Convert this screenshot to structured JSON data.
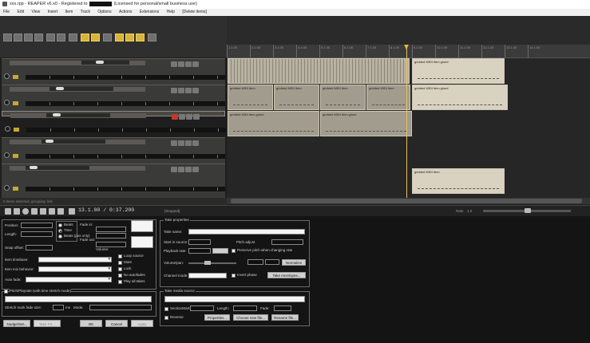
{
  "window": {
    "title_prefix": "xxx.rpp - REAPER v6.x0 - Registered to",
    "title_suffix": "(Licensed for personal/small business use)"
  },
  "menu": [
    "File",
    "Edit",
    "View",
    "Insert",
    "Item",
    "Track",
    "Options",
    "Actions",
    "Extensions",
    "Help",
    "[Delete items]"
  ],
  "tracks": [
    {
      "name": "",
      "items": [
        {
          "label": ""
        },
        {
          "label": "gridded MIDI item glued"
        }
      ]
    },
    {
      "name": "",
      "items": [
        {
          "label": "gridded MIDI item"
        },
        {
          "label": "gridded MIDI item"
        },
        {
          "label": "gridded MIDI item"
        },
        {
          "label": "gridded MIDI item"
        },
        {
          "label": "gridded MIDI item glued"
        }
      ]
    },
    {
      "name": "",
      "items": [
        {
          "label": "gridded MIDI item glued"
        },
        {
          "label": "gridded MIDI item glued"
        }
      ]
    },
    {
      "name": "",
      "items": []
    },
    {
      "name": "",
      "items": [
        {
          "label": "gridded MIDI item"
        }
      ]
    }
  ],
  "ruler_labels": [
    "1.1.00",
    "2.1.00",
    "3.1.00",
    "4.1.00",
    "5.1.00",
    "6.1.00",
    "7.1.00",
    "8.1.00",
    "9.1.00",
    "10.1.00",
    "11.1.00",
    "12.1.00",
    "13.1.00",
    "14.1.00"
  ],
  "tcp_footer": "0 items selected, grouping: link",
  "transport": {
    "time": "13.1.00 / 0:37.200",
    "status": "[Stopped]",
    "rate_label": "Rate",
    "rate_value": "1.0"
  },
  "dialog": {
    "position": {
      "label": "Position:",
      "value": ""
    },
    "length": {
      "label": "Length:",
      "value": ""
    },
    "fade_in": {
      "label": "Fade in:",
      "value": ""
    },
    "fade_out": {
      "label": "Fade out:",
      "value": ""
    },
    "snap_offset": {
      "label": "Snap offset:",
      "value": ""
    },
    "volume_label": "Volume:",
    "timebase_opts": [
      "Beats",
      "Time",
      "Beats (pos only)"
    ],
    "timebase_selected": 1,
    "item_timebase": {
      "label": "Item timebase:",
      "value": ""
    },
    "item_mix_behavior": {
      "label": "Item mix behavior:",
      "value": ""
    },
    "auto_fade": {
      "label": "Auto fade:",
      "value": ""
    },
    "flags": [
      "Loop source",
      "Mute",
      "Lock",
      "No autofades",
      "Play all takes"
    ],
    "pitch_group": {
      "label": "Pitch/Playrate (with time stretch mode)",
      "value": ""
    },
    "stretch_label": "Stretch mark fade size:",
    "stretch_unit": "ms",
    "stretch_value": "",
    "mode_label": "Mode:",
    "mode_value": "",
    "take_group": "Take properties",
    "take_name": {
      "label": "Take name:",
      "value": ""
    },
    "start_offset": {
      "label": "Start in source:",
      "value": ""
    },
    "playback_rate": {
      "label": "Playback rate:",
      "value": ""
    },
    "preserve_pitch": "Preserve pitch when changing rate",
    "take_volume": {
      "label": "Volume/pan:",
      "value": ""
    },
    "take_pitch": {
      "label": "Take pitch:",
      "value": ""
    },
    "pitch_adjust": "Pitch adjust",
    "take_envelopes_btn": "Take envelopes...",
    "normalize_btn": "Normalize",
    "channel_mode_label": "Channel mode:",
    "invert_phase": "Invert phase",
    "media_group": "Take media source",
    "media_file": "",
    "section_label": "Section:",
    "start_label": "Start:",
    "length2_label": "Length:",
    "fade_label": "Fade:",
    "reverse_label": "Reverse",
    "properties_btn": "Properties...",
    "choose_btn": "Choose new file...",
    "rename_btn": "Rename file...",
    "nudge_btn": "Nudge/Set...",
    "take_fx_btn": "Take FX...",
    "ok": "OK",
    "cancel": "Cancel",
    "apply": "Apply"
  }
}
